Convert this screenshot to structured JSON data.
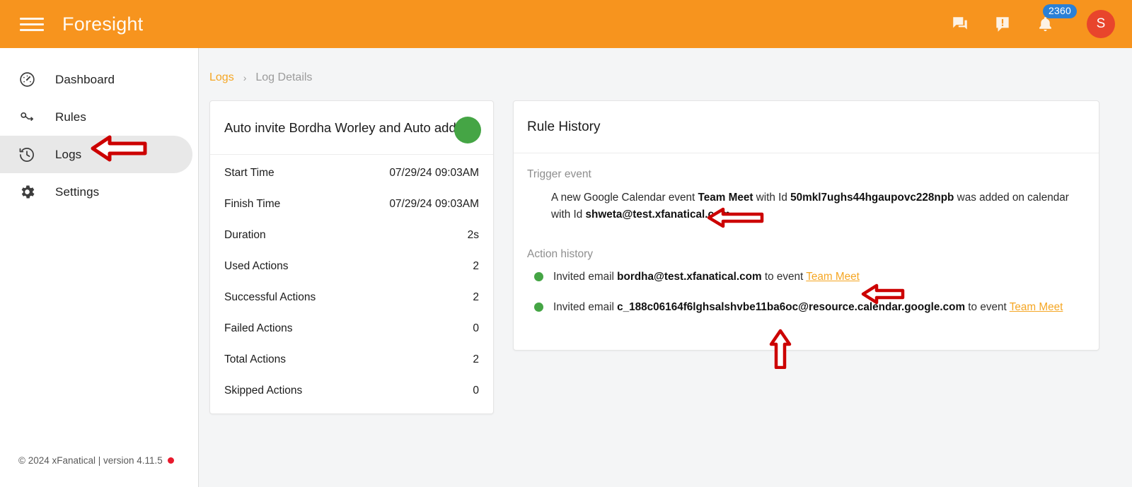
{
  "app": {
    "title": "Foresight",
    "menu_icon": "hamburger-menu-icon",
    "accent_orange": "#f7941e",
    "link_orange": "#f5a623",
    "green": "#45a545",
    "badge_blue": "#2a80d6",
    "avatar_red": "#e8452c",
    "annotation_red": "#cc0000"
  },
  "header": {
    "chat_icon": "chat-bubbles-icon",
    "feedback_icon": "announcement-icon",
    "notifications_icon": "bell-icon",
    "notification_count": "2360",
    "avatar_initial": "S"
  },
  "sidebar": {
    "items": [
      {
        "label": "Dashboard",
        "icon": "speedometer-icon",
        "selected": false
      },
      {
        "label": "Rules",
        "icon": "key-flow-icon",
        "selected": false
      },
      {
        "label": "Logs",
        "icon": "history-clock-icon",
        "selected": true
      },
      {
        "label": "Settings",
        "icon": "gear-icon",
        "selected": false
      }
    ],
    "footer": "© 2024 xFanatical | version 4.11.5"
  },
  "breadcrumb": {
    "link": "Logs",
    "separator": "›",
    "current": "Log Details"
  },
  "summary": {
    "title": "Auto invite Bordha Worley and Auto add R",
    "status": "success",
    "rows": [
      {
        "key": "Start Time",
        "value": "07/29/24 09:03AM"
      },
      {
        "key": "Finish Time",
        "value": "07/29/24 09:03AM"
      },
      {
        "key": "Duration",
        "value": "2s"
      },
      {
        "key": "Used Actions",
        "value": "2"
      },
      {
        "key": "Successful Actions",
        "value": "2"
      },
      {
        "key": "Failed Actions",
        "value": "0"
      },
      {
        "key": "Total Actions",
        "value": "2"
      },
      {
        "key": "Skipped Actions",
        "value": "0"
      }
    ]
  },
  "rule_history": {
    "title": "Rule History",
    "trigger_label": "Trigger event",
    "trigger": {
      "prefix": "A new Google Calendar event ",
      "event_name": "Team Meet",
      "mid1": " with Id ",
      "event_id": "50mkl7ughs44hgaupovc228npb",
      "mid2": " was added on calendar with Id ",
      "calendar_id": "shweta@test.xfanatical.com",
      "suffix": "."
    },
    "action_label": "Action history",
    "actions": [
      {
        "status": "success",
        "prefix": "Invited email ",
        "email": "bordha@test.xfanatical.com",
        "mid": " to event ",
        "event_link": "Team Meet"
      },
      {
        "status": "success",
        "prefix": "Invited email ",
        "email": "c_188c06164f6lghsalshvbe11ba6oc@resource.calendar.google.com",
        "mid": " to event ",
        "event_link": "Team Meet"
      }
    ]
  },
  "annotations": [
    {
      "name": "arrow-pointing-logs-nav",
      "direction": "left"
    },
    {
      "name": "arrow-pointing-calendar-id",
      "direction": "left"
    },
    {
      "name": "arrow-pointing-first-event-link",
      "direction": "left"
    },
    {
      "name": "arrow-pointing-resource-email",
      "direction": "up"
    }
  ]
}
